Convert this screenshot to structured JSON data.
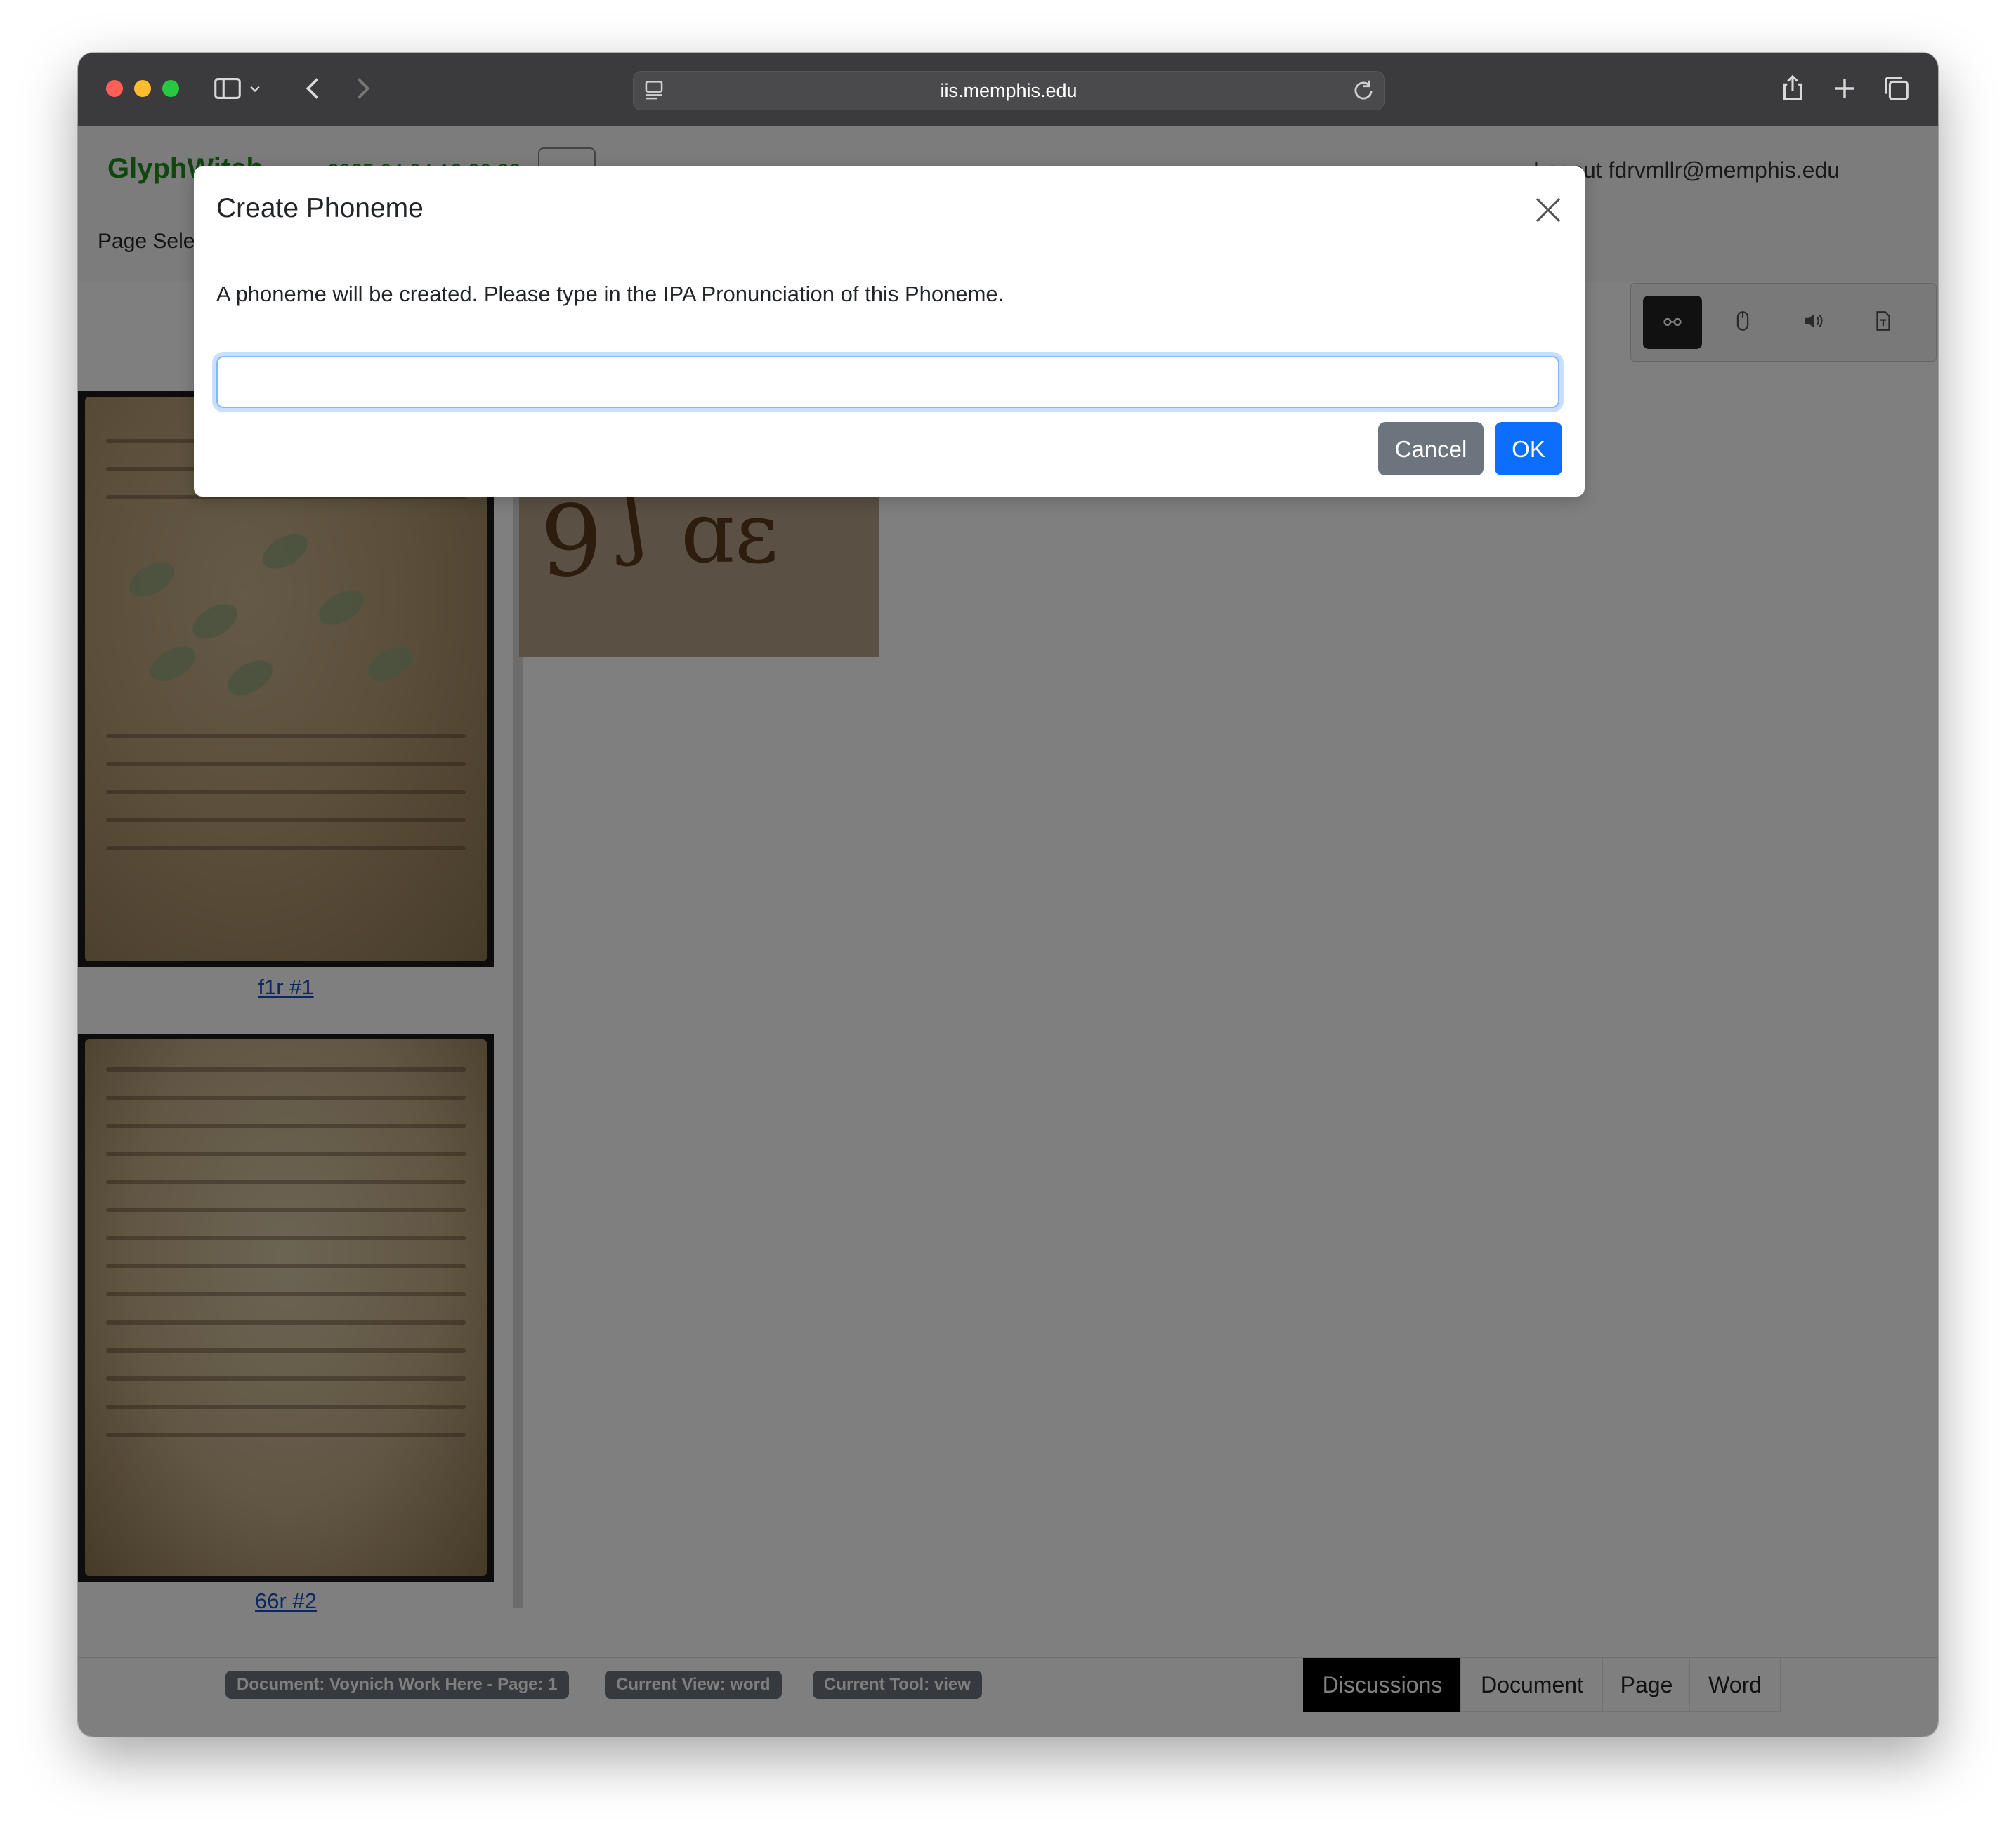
{
  "browser": {
    "url": "iis.memphis.edu"
  },
  "app": {
    "brand": "GlyphWitch",
    "date_fragment": "2025 04 04 12 20 22",
    "user": "Logout fdrvmllr@memphis.edu",
    "page_select_label": "Page Sele"
  },
  "thumbnails": [
    {
      "label": "f1r #1"
    },
    {
      "label": "66r #2"
    }
  ],
  "status": {
    "document": "Document: Voynich Work Here - Page: 1",
    "view": "Current View: word",
    "tool": "Current Tool: view"
  },
  "bottom_tabs": [
    {
      "label": "Discussions",
      "active": true
    },
    {
      "label": "Document",
      "active": false
    },
    {
      "label": "Page",
      "active": false
    },
    {
      "label": "Word",
      "active": false
    }
  ],
  "tools": [
    {
      "icon": "glasses-icon",
      "active": true
    },
    {
      "icon": "mouse-icon",
      "active": false
    },
    {
      "icon": "speaker-icon",
      "active": false
    },
    {
      "icon": "text-file-icon",
      "active": false
    }
  ],
  "modal": {
    "title": "Create Phoneme",
    "message": "A phoneme will be created. Please type in the IPA Pronunciation of this Phoneme.",
    "input_value": "",
    "cancel_label": "Cancel",
    "ok_label": "OK"
  },
  "colors": {
    "accent": "#0d6efd",
    "secondary": "#6c757d",
    "brand": "#1f8f1f"
  }
}
